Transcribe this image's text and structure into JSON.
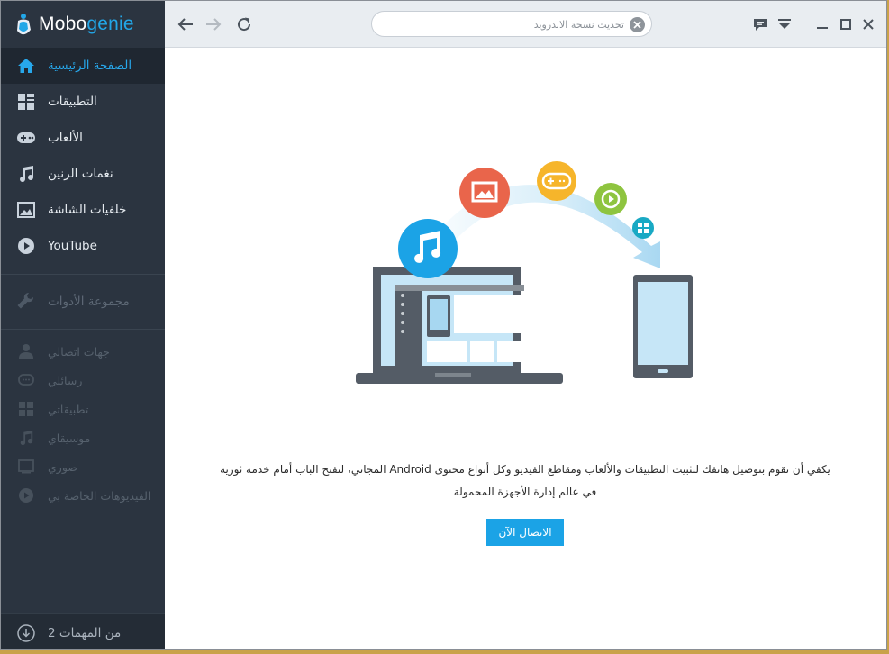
{
  "app": {
    "logo_prefix": "Mobo",
    "logo_suffix": "genie"
  },
  "sidebar": {
    "nav": [
      {
        "label": "الصفحة الرئيسية",
        "icon": "home-icon"
      },
      {
        "label": "التطبيقات",
        "icon": "apps-grid-icon"
      },
      {
        "label": "الألعاب",
        "icon": "gamepad-icon"
      },
      {
        "label": "نغمات الرنين",
        "icon": "music-note-icon"
      },
      {
        "label": "خلفيات الشاشة",
        "icon": "wallpaper-icon"
      },
      {
        "label": "YouTube",
        "icon": "play-icon"
      }
    ],
    "tools_label": "مجموعة الأدوات",
    "mine": [
      {
        "label": "جهات اتصالي",
        "icon": "contact-icon"
      },
      {
        "label": "رسائلي",
        "icon": "message-icon"
      },
      {
        "label": "تطبيقاتي",
        "icon": "apps-grid-icon"
      },
      {
        "label": "موسيقاي",
        "icon": "music-note-icon"
      },
      {
        "label": "صوري",
        "icon": "picture-icon"
      },
      {
        "label": "الفيديوهات الخاصة بي",
        "icon": "video-icon"
      }
    ],
    "tasks_label": "2 من المهمات"
  },
  "topbar": {
    "search_placeholder": "تحديث نسخة الاندرويد"
  },
  "main": {
    "description_line1": "يكفي أن تقوم بتوصيل هاتفك لتثبيت التطبيقات والألعاب ومقاطع الفيديو وكل أنواع محتوى Android المجاني، لتفتح الباب أمام خدمة ثورية",
    "description_line2": "في عالم إدارة الأجهزة المحمولة",
    "connect_label": "الاتصال الآن"
  },
  "colors": {
    "accent": "#1ba3e6",
    "sidebar_bg": "#2b3440",
    "active_text": "#27a8ec"
  }
}
